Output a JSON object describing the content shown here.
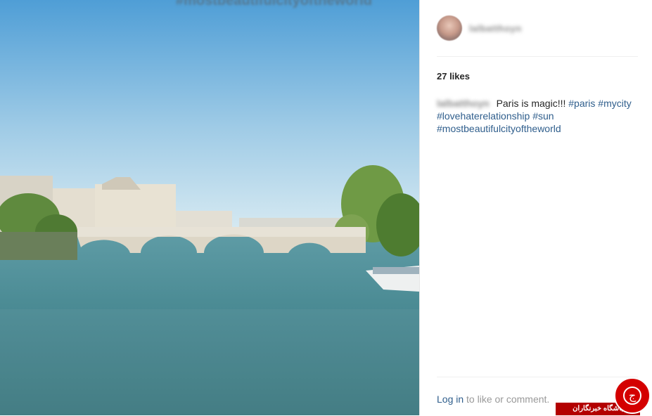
{
  "post": {
    "username": "lalbatthoyn",
    "likes": "27 likes",
    "caption_user": "lalbatthoyn",
    "caption_text": "Paris is magic!!!",
    "hashtags": [
      "#paris",
      "#mycity",
      "#lovehaterelationship",
      "#sun",
      "#mostbeautifulcityoftheworld"
    ]
  },
  "top_overlay_text": "#mostbeautifulcityoftheworld",
  "footer": {
    "login_link": "Log in",
    "login_suffix": "to like or comment."
  },
  "watermark": {
    "label": "باشگاه خبرنگاران",
    "logo_glyph": "ج"
  },
  "colors": {
    "link": "#2f5e8c",
    "sky_top": "#5aa4d8",
    "water": "#3f7e86",
    "watermark_red": "#b30000"
  },
  "icons": {
    "avatar": "profile-avatar",
    "watermark": "news-agency-logo"
  }
}
